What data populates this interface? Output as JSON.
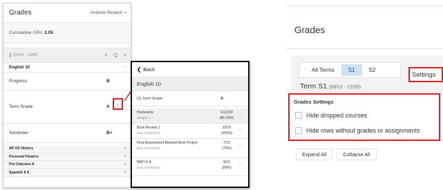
{
  "left_panel": {
    "title": "Grades",
    "student": "Andrew Student",
    "gpa_label": "Cumulative GPA:",
    "gpa_value": "2.05",
    "term_label": "1",
    "term_range": "(07/03 - 10/06)",
    "term_nav": [
      "<",
      "Q",
      ">"
    ],
    "course": "English 10",
    "course_collapse": "−",
    "rows": [
      {
        "label": "Progress",
        "value": "B"
      },
      {
        "label": "Term Grade",
        "value": "A"
      },
      {
        "label": "Semester",
        "value": "B+"
      }
    ],
    "courses": [
      {
        "name": "AP US History",
        "toggle": "+"
      },
      {
        "name": "Personal Finance",
        "toggle": "+"
      },
      {
        "name": "Pre-Calculus A",
        "toggle": "+"
      },
      {
        "name": "Spanish II A",
        "toggle": "+"
      }
    ]
  },
  "popup": {
    "back_label": "Back",
    "course": "English 10",
    "term_grade_label": "(1) Term Grade",
    "term_grade_value": "A",
    "category": {
      "name": "Homework",
      "sub": "Weight: 1",
      "score": "112/130",
      "pct": "(86.15%)",
      "toggle": "−"
    },
    "assignments": [
      {
        "name": "Book Review 1",
        "due": "Due: 07/24/2017",
        "score": "10/10",
        "pct": "(100%)"
      },
      {
        "name": "Final Assessment Banned Book Project",
        "due": "Due: 07/21/2017",
        "score": "7/10",
        "pct": "(70%)"
      },
      {
        "name": "BBP DI A",
        "due": "Due: 07/19/2017",
        "score": "8/10",
        "pct": "(80%)"
      }
    ]
  },
  "right_panel": {
    "title": "Grades",
    "tabs": [
      "All Terms",
      "S1",
      "S2"
    ],
    "active_tab": "S1",
    "term_label": "Term S1",
    "term_range": "(08/12 - 12/20)",
    "settings_label": "Settings",
    "grade_settings": {
      "heading": "Grades Settings",
      "options": [
        "Hide dropped courses",
        "Hide rows without grades or assignments"
      ]
    },
    "buttons": [
      "Expand All",
      "Collapse All"
    ]
  },
  "colors": {
    "highlight": "#e02020",
    "active_tab": "#cfe2f3"
  }
}
